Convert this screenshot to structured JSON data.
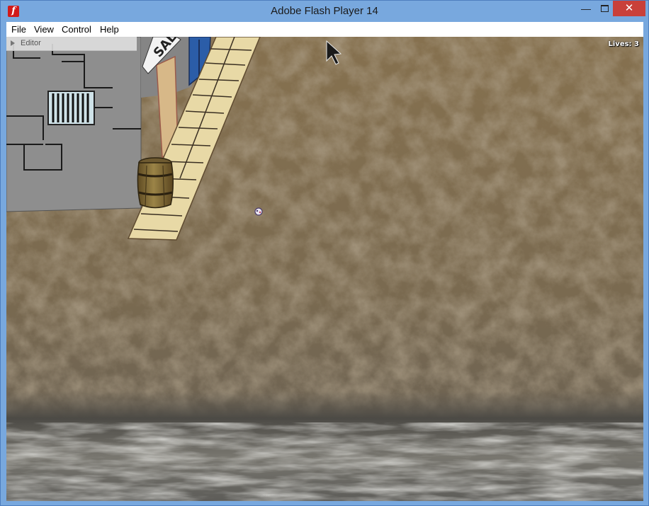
{
  "window": {
    "title": "Adobe Flash Player 14",
    "icon": "flash-player-icon",
    "controls": {
      "minimize": "—",
      "close": "✕"
    }
  },
  "menu": [
    {
      "label": "File"
    },
    {
      "label": "View"
    },
    {
      "label": "Control"
    },
    {
      "label": "Help"
    }
  ],
  "game": {
    "editor_label": "Editor",
    "lives_text": "Lives: 3",
    "building_sign": "SAL"
  },
  "colors": {
    "titlebar": "#78a8de",
    "close_button": "#c9403a",
    "building_wall": "#8e8e8e",
    "boardwalk": "#e8d9a6",
    "ground": "#7d6b4f",
    "water": "#6e6e6a"
  }
}
